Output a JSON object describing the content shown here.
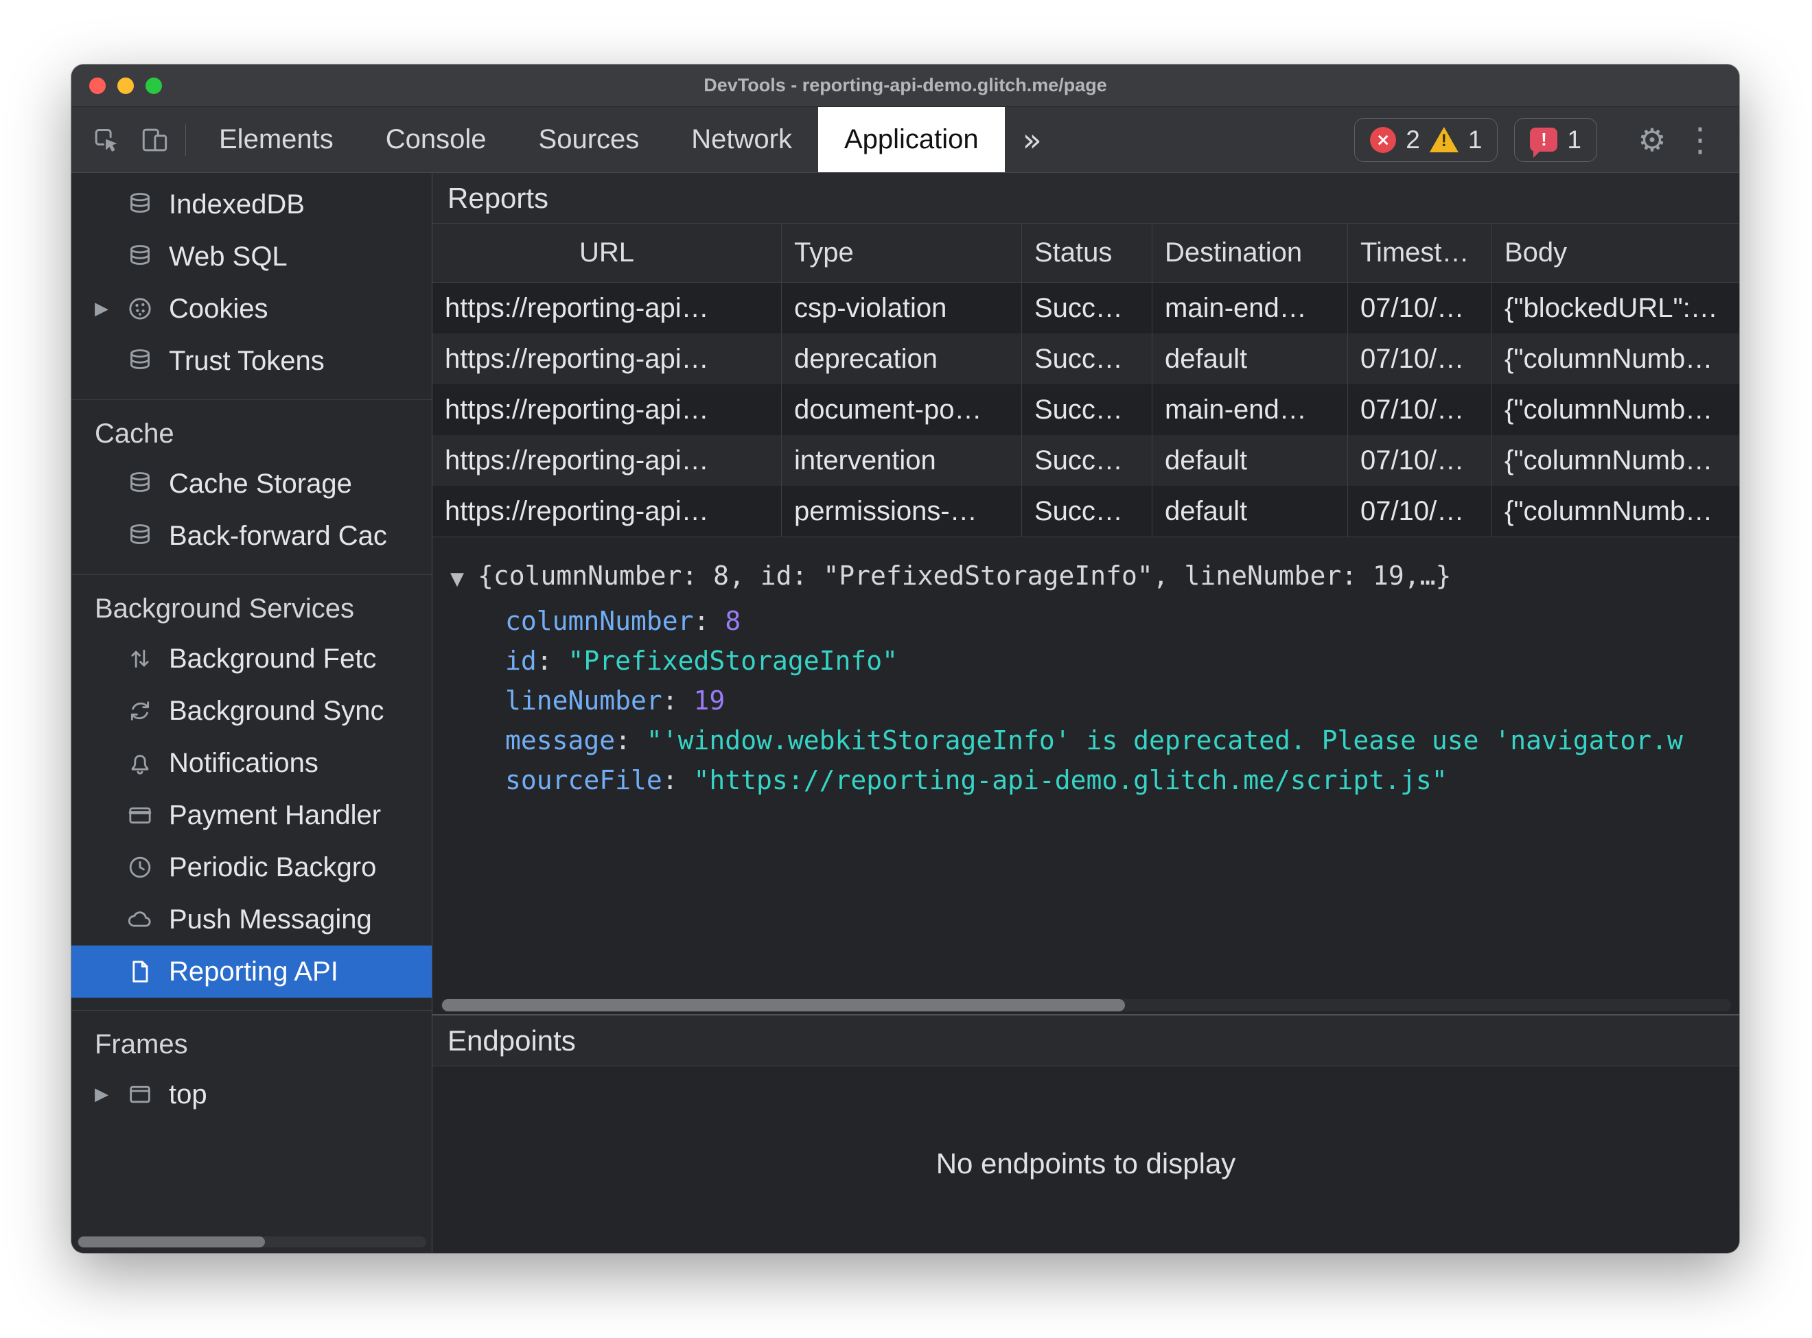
{
  "window": {
    "title": "DevTools - reporting-api-demo.glitch.me/page"
  },
  "toolbar": {
    "tabs": [
      {
        "label": "Elements"
      },
      {
        "label": "Console"
      },
      {
        "label": "Sources"
      },
      {
        "label": "Network"
      },
      {
        "label": "Application"
      }
    ],
    "active_tab": "Application",
    "error_count": "2",
    "warning_count": "1",
    "issues_count": "1"
  },
  "icons": {
    "disclosure_collapsed": "▶",
    "disclosure_expanded": "▼",
    "more_tabs": "»",
    "gear": "⚙",
    "kebab": "⋮",
    "error_x": "×",
    "warning_mark": "!",
    "issue_mark": "!"
  },
  "sidebar": {
    "top_items": [
      {
        "label": "IndexedDB"
      },
      {
        "label": "Web SQL"
      },
      {
        "label": "Cookies"
      },
      {
        "label": "Trust Tokens"
      }
    ],
    "sections": [
      {
        "title": "Cache",
        "items": [
          {
            "label": "Cache Storage"
          },
          {
            "label": "Back-forward Cac"
          }
        ]
      },
      {
        "title": "Background Services",
        "items": [
          {
            "label": "Background Fetc"
          },
          {
            "label": "Background Sync"
          },
          {
            "label": "Notifications"
          },
          {
            "label": "Payment Handler"
          },
          {
            "label": "Periodic Backgro"
          },
          {
            "label": "Push Messaging"
          },
          {
            "label": "Reporting API"
          }
        ]
      },
      {
        "title": "Frames",
        "items": [
          {
            "label": "top"
          }
        ]
      }
    ],
    "selected_item": "Reporting API"
  },
  "reports": {
    "title": "Reports",
    "columns": [
      "URL",
      "Type",
      "Status",
      "Destination",
      "Timest…",
      "Body"
    ],
    "rows": [
      [
        "https://reporting-api…",
        "csp-violation",
        "Succ…",
        "main-end…",
        "07/10/…",
        "{\"blockedURL\":…"
      ],
      [
        "https://reporting-api…",
        "deprecation",
        "Succ…",
        "default",
        "07/10/…",
        "{\"columnNumb…"
      ],
      [
        "https://reporting-api…",
        "document-po…",
        "Succ…",
        "main-end…",
        "07/10/…",
        "{\"columnNumb…"
      ],
      [
        "https://reporting-api…",
        "intervention",
        "Succ…",
        "default",
        "07/10/…",
        "{\"columnNumb…"
      ],
      [
        "https://reporting-api…",
        "permissions-…",
        "Succ…",
        "default",
        "07/10/…",
        "{\"columnNumb…"
      ]
    ]
  },
  "detail": {
    "preview": "{columnNumber: 8, id: \"PrefixedStorageInfo\", lineNumber: 19,…}",
    "properties": [
      {
        "key": "columnNumber",
        "value": "8"
      },
      {
        "key": "id",
        "value": "\"PrefixedStorageInfo\""
      },
      {
        "key": "lineNumber",
        "value": "19"
      },
      {
        "key": "message",
        "value": "\"'window.webkitStorageInfo' is deprecated. Please use 'navigator.w"
      },
      {
        "key": "sourceFile",
        "value": "\"https://reporting-api-demo.glitch.me/script.js\""
      }
    ]
  },
  "endpoints": {
    "title": "Endpoints",
    "empty_message": "No endpoints to display"
  },
  "colors": {
    "selection_blue": "#2a6ccc",
    "active_tab_bg": "#ffffff",
    "error_red": "#e5484d",
    "warning_yellow": "#f0b41e",
    "issue_pink": "#e04b5f",
    "json_key_blue": "#71aef5",
    "json_number_purple": "#9a7cf5",
    "json_string_teal": "#35d4c7"
  }
}
